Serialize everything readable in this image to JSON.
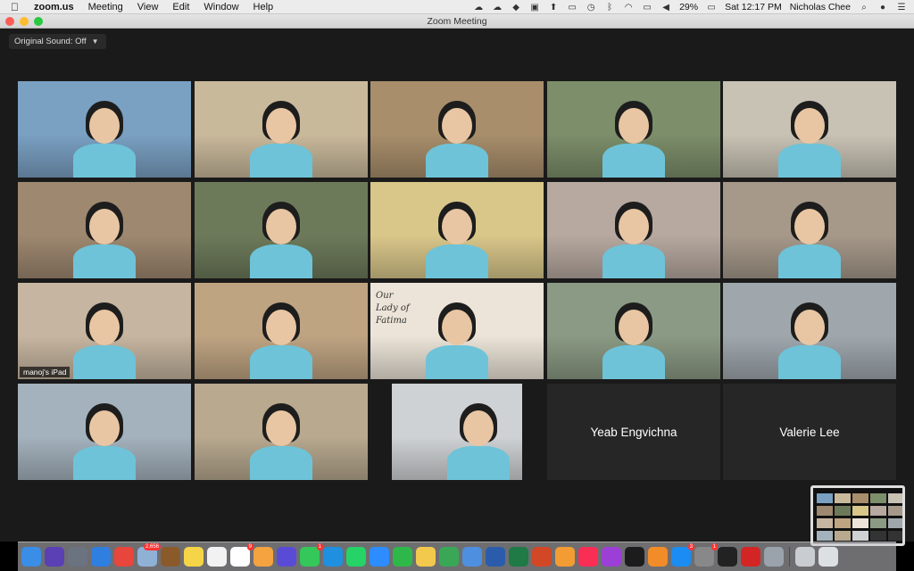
{
  "menubar": {
    "app_name": "zoom.us",
    "menus": [
      "Meeting",
      "View",
      "Edit",
      "Window",
      "Help"
    ],
    "battery": "29%",
    "clock": "Sat 12:17 PM",
    "user": "Nicholas Chee"
  },
  "window": {
    "title": "Zoom Meeting",
    "sound_button_label": "Original Sound: Off"
  },
  "participants": [
    {
      "name": "",
      "bg": "#7aa0c2"
    },
    {
      "name": "",
      "bg": "#c9b99b"
    },
    {
      "name": "",
      "bg": "#a88e6b"
    },
    {
      "name": "",
      "bg": "#7c8e6a"
    },
    {
      "name": "",
      "bg": "#c8c2b4"
    },
    {
      "name": "",
      "bg": "#9e8870"
    },
    {
      "name": "",
      "bg": "#6d7a5a"
    },
    {
      "name": "",
      "bg": "#d9c78a"
    },
    {
      "name": "",
      "bg": "#b7a9a0"
    },
    {
      "name": "",
      "bg": "#a6998a"
    },
    {
      "name": "manoj's iPad",
      "bg": "#c6b5a0"
    },
    {
      "name": "",
      "bg": "#bfa482"
    },
    {
      "name": "",
      "bg": "#ece4d8"
    },
    {
      "name": "",
      "bg": "#8b9a84"
    },
    {
      "name": "",
      "bg": "#9fa7ad"
    },
    {
      "name": "",
      "bg": "#a4b2bd"
    },
    {
      "name": "",
      "bg": "#b8a98f"
    },
    {
      "name": "",
      "bg": "#cfd2d4"
    },
    {
      "name": "Yeab Engvichna",
      "bg": ""
    },
    {
      "name": "Valerie Lee",
      "bg": ""
    }
  ],
  "tile_text": {
    "fatima_sign": "Our Lady of Fatima"
  },
  "dock": {
    "icons": [
      {
        "icon": "finder-icon",
        "color": "#3a8ee6",
        "badge": ""
      },
      {
        "icon": "siri-icon",
        "color": "#5b3fb5",
        "badge": ""
      },
      {
        "icon": "launchpad-icon",
        "color": "#6b7280",
        "badge": ""
      },
      {
        "icon": "safari-icon",
        "color": "#2f7fe0",
        "badge": ""
      },
      {
        "icon": "chrome-icon",
        "color": "#e8453c",
        "badge": ""
      },
      {
        "icon": "preview-icon",
        "color": "#8fb1d6",
        "badge": "2,656"
      },
      {
        "icon": "notes-brown-icon",
        "color": "#8b5a2b",
        "badge": ""
      },
      {
        "icon": "notes-icon",
        "color": "#f5d547",
        "badge": ""
      },
      {
        "icon": "reminders-icon",
        "color": "#f2f2f2",
        "badge": ""
      },
      {
        "icon": "calendar-icon",
        "color": "#ffffff",
        "badge": "9"
      },
      {
        "icon": "photos-icon",
        "color": "#f4a340",
        "badge": ""
      },
      {
        "icon": "star-app-icon",
        "color": "#5a4bd6",
        "badge": ""
      },
      {
        "icon": "messages-icon",
        "color": "#34c759",
        "badge": "1"
      },
      {
        "icon": "skype-icon",
        "color": "#1f8fe0",
        "badge": ""
      },
      {
        "icon": "whatsapp-icon",
        "color": "#25d366",
        "badge": ""
      },
      {
        "icon": "zoom-icon",
        "color": "#2d8cff",
        "badge": ""
      },
      {
        "icon": "facetime-icon",
        "color": "#2fb84a",
        "badge": ""
      },
      {
        "icon": "sheets-icon",
        "color": "#f2c94c",
        "badge": ""
      },
      {
        "icon": "numbers-icon",
        "color": "#3aa757",
        "badge": ""
      },
      {
        "icon": "keynote-icon",
        "color": "#4e8fe0",
        "badge": ""
      },
      {
        "icon": "word-icon",
        "color": "#2b5cab",
        "badge": ""
      },
      {
        "icon": "excel-icon",
        "color": "#1f7a45",
        "badge": ""
      },
      {
        "icon": "powerpoint-icon",
        "color": "#d24726",
        "badge": ""
      },
      {
        "icon": "pages-icon",
        "color": "#f39c33",
        "badge": ""
      },
      {
        "icon": "music-icon",
        "color": "#fa2d55",
        "badge": ""
      },
      {
        "icon": "podcasts-icon",
        "color": "#9c3fd6",
        "badge": ""
      },
      {
        "icon": "apple-tv-icon",
        "color": "#1c1c1c",
        "badge": ""
      },
      {
        "icon": "books-icon",
        "color": "#f28c28",
        "badge": ""
      },
      {
        "icon": "app-store-icon",
        "color": "#1b8cf2",
        "badge": "3"
      },
      {
        "icon": "system-preferences-icon",
        "color": "#888888",
        "badge": "1"
      },
      {
        "icon": "activity-monitor-icon",
        "color": "#222222",
        "badge": ""
      },
      {
        "icon": "acrobat-icon",
        "color": "#d42525",
        "badge": ""
      },
      {
        "icon": "screenshot-icon",
        "color": "#9aa3ab",
        "badge": ""
      },
      {
        "icon": "downloads-stack-icon",
        "color": "#c9ccd0",
        "badge": ""
      },
      {
        "icon": "trash-icon",
        "color": "#dde0e3",
        "badge": ""
      }
    ]
  }
}
